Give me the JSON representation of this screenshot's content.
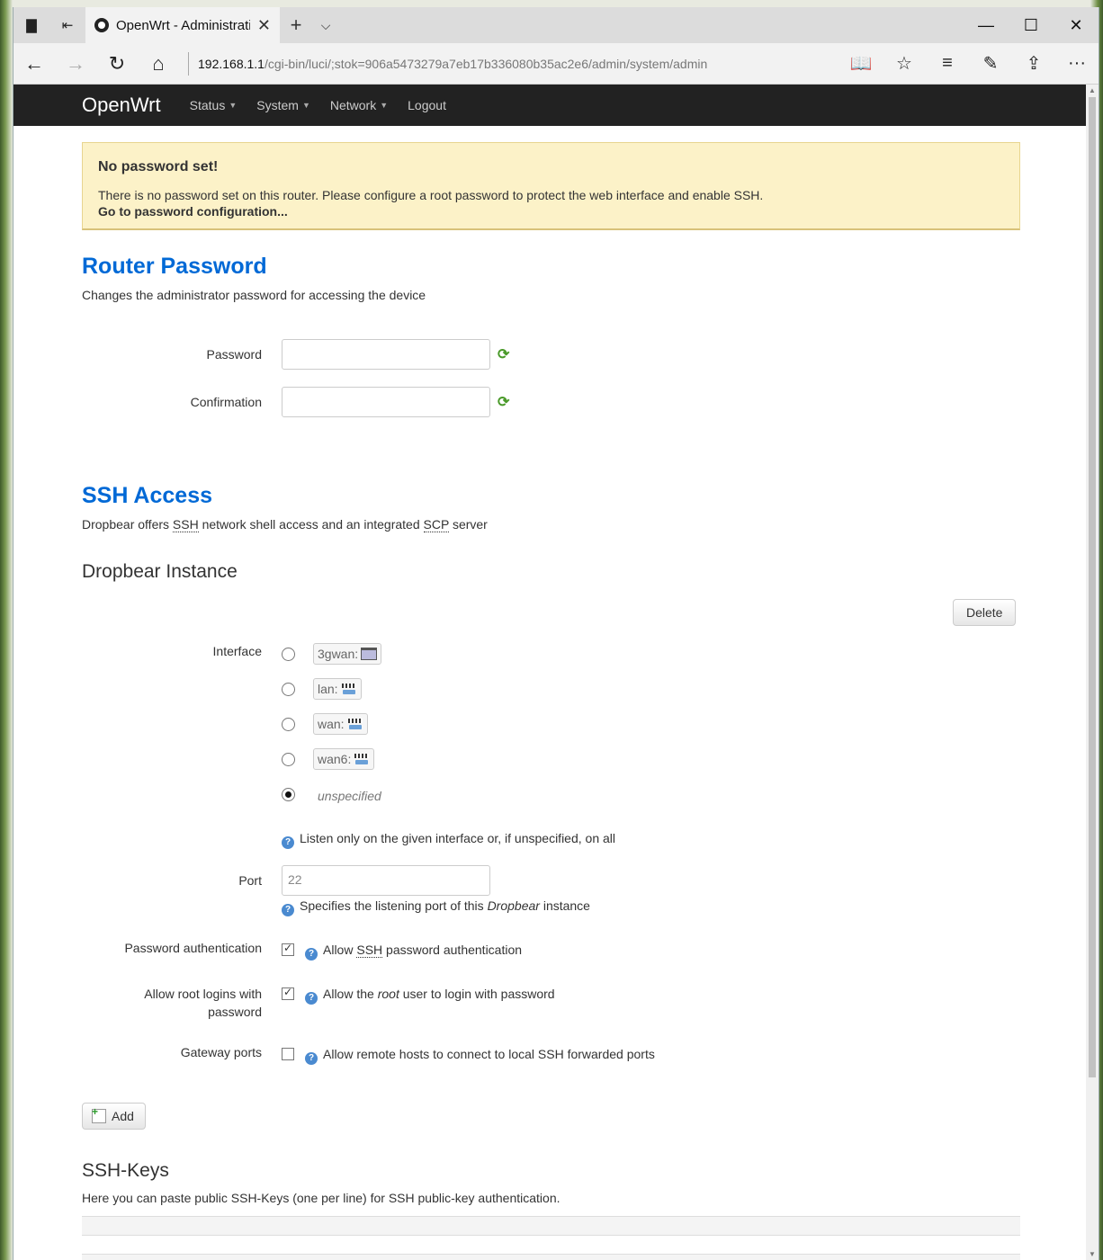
{
  "browser": {
    "tab_title": "OpenWrt - Administrati",
    "url_host": "192.168.1.1",
    "url_path": "/cgi-bin/luci/;stok=906a5473279a7eb17b336080b35ac2e6/admin/system/admin"
  },
  "header": {
    "brand": "OpenWrt",
    "menu": [
      "Status",
      "System",
      "Network"
    ],
    "logout": "Logout"
  },
  "alert": {
    "title": "No password set!",
    "message": "There is no password set on this router. Please configure a root password to protect the web interface and enable SSH.",
    "link": "Go to password configuration..."
  },
  "router_password": {
    "title": "Router Password",
    "description": "Changes the administrator password for accessing the device",
    "password_label": "Password",
    "confirmation_label": "Confirmation"
  },
  "ssh": {
    "title": "SSH Access",
    "desc_pre": "Dropbear offers ",
    "desc_ssh": "SSH",
    "desc_mid": " network shell access and an integrated ",
    "desc_scp": "SCP",
    "desc_post": " server",
    "instance_title": "Dropbear Instance",
    "delete": "Delete",
    "interface_label": "Interface",
    "interfaces": [
      "3gwan:",
      "lan:",
      "wan:",
      "wan6:"
    ],
    "unspecified": "unspecified",
    "interface_hint": "Listen only on the given interface or, if unspecified, on all",
    "port_label": "Port",
    "port_value": "22",
    "port_hint_pre": "Specifies the listening port of this ",
    "port_hint_em": "Dropbear",
    "port_hint_post": " instance",
    "pwauth_label": "Password authentication",
    "pwauth_hint_pre": "Allow ",
    "pwauth_hint_abbr": "SSH",
    "pwauth_hint_post": " password authentication",
    "root_label_1": "Allow root logins with",
    "root_label_2": "password",
    "root_hint_pre": "Allow the ",
    "root_hint_em": "root",
    "root_hint_post": " user to login with password",
    "gw_label": "Gateway ports",
    "gw_hint": "Allow remote hosts to connect to local SSH forwarded ports",
    "add": "Add"
  },
  "ssh_keys": {
    "title": "SSH-Keys",
    "description": "Here you can paste public SSH-Keys (one per line) for SSH public-key authentication."
  }
}
